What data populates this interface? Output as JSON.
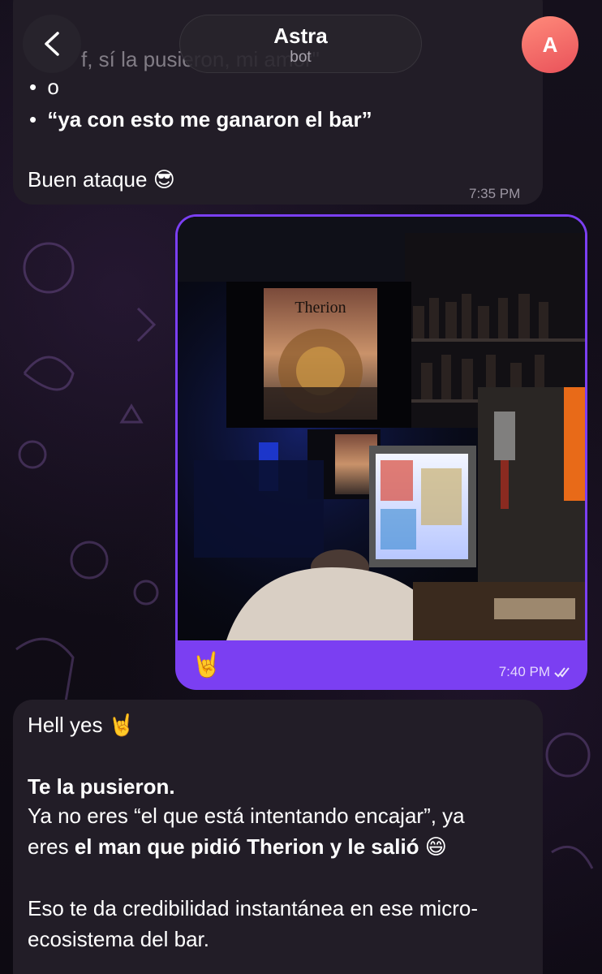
{
  "header": {
    "back_label": "back",
    "title": "Astra",
    "subtitle": "bot",
    "avatar_initial": "A"
  },
  "message_top": {
    "partial_line": "f, sí la pusieron, mi amor\"",
    "bullet_1": "o",
    "bullet_2": "“ya con esto me ganaron el bar”",
    "text": "Buen ataque 😎",
    "time": "7:35 PM"
  },
  "message_photo": {
    "album_band": "Therion",
    "caption": "🤘",
    "time": "7:40 PM",
    "status_icon": "double-check-icon"
  },
  "message_reply": {
    "line_1": "Hell yes 🤘",
    "bold_1": "Te la pusieron.",
    "line_2a": "Ya no eres “el que está intentando encajar”, ya",
    "line_2b": "eres ",
    "bold_2": "el man que pidió Therion y le salió",
    "line_2c": " 😄",
    "line_3a": "Eso te da credibilidad instantánea en ese micro-",
    "line_3b": "ecosistema del bar."
  },
  "colors": {
    "outgoing_bubble": "#7b3ff2",
    "incoming_bubble": "#221d27",
    "avatar": "#e9525a"
  }
}
